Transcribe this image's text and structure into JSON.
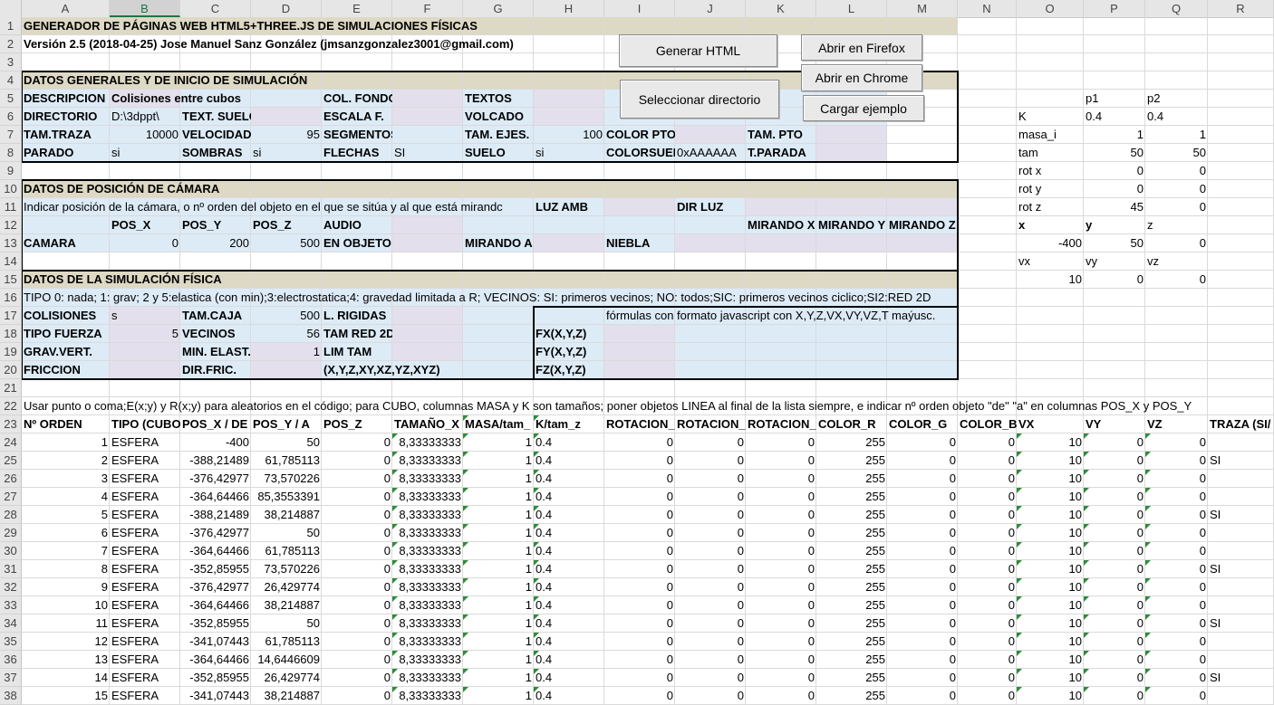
{
  "columns": [
    "A",
    "B",
    "C",
    "D",
    "E",
    "F",
    "G",
    "H",
    "I",
    "J",
    "K",
    "L",
    "M",
    "N",
    "O",
    "P",
    "Q",
    "R"
  ],
  "selected_column": "B",
  "rows": [
    "1",
    "2",
    "3",
    "4",
    "5",
    "6",
    "7",
    "8",
    "9",
    "10",
    "11",
    "12",
    "13",
    "14",
    "15",
    "16",
    "17",
    "18",
    "19",
    "20",
    "21",
    "22",
    "23",
    "24",
    "25",
    "26",
    "27",
    "28",
    "29",
    "30",
    "31",
    "32",
    "33",
    "34",
    "35",
    "36",
    "37",
    "38"
  ],
  "header": {
    "title": "GENERADOR DE PÁGINAS WEB HTML5+THREE.JS DE SIMULACIONES FÍSICAS",
    "version": "Versión 2.5 (2018-04-25) Jose Manuel Sanz González (jmsanzgonzalez3001@gmail.com)"
  },
  "buttons": {
    "generar": "Generar HTML",
    "seleccionar": "Seleccionar directorio",
    "firefox": "Abrir en Firefox",
    "chrome": "Abrir en Chrome",
    "ejemplo": "Cargar ejemplo"
  },
  "general": {
    "section": "DATOS GENERALES Y DE INICIO DE SIMULACIÓN",
    "descripcion_label": "DESCRIPCION",
    "descripcion_value": "Colisiones entre cubos",
    "col_fondo_label": "COL. FONDO",
    "textos_label": "TEXTOS",
    "directorio_label": "DIRECTORIO",
    "directorio_value": "D:\\3dppt\\",
    "text_suelo_label": "TEXT. SUELO",
    "escala_label": "ESCALA F.",
    "volcado_label": "VOLCADO",
    "tam_traza_label": "TAM.TRAZA",
    "tam_traza_value": "10000",
    "velocidad_label": "VELOCIDAD",
    "velocidad_value": "95",
    "segmentos_label": "SEGMENTOS",
    "tam_ejes_label": "TAM. EJES.",
    "tam_ejes_value": "100",
    "color_pto_label": "COLOR PTO",
    "tam_pto_label": "TAM. PTO",
    "parado_label": "PARADO",
    "parado_value": "si",
    "sombras_label": "SOMBRAS",
    "sombras_value": "si",
    "flechas_label": "FLECHAS",
    "flechas_value": "SI",
    "suelo_label": "SUELO",
    "suelo_value": "si",
    "colorsuelo_label": "COLORSUEL",
    "colorsuelo_value": "0xAAAAAA",
    "t_parada_label": "T.PARADA"
  },
  "camera": {
    "section": "DATOS DE POSICIÓN DE CÁMARA",
    "hint": "Indicar posición de la cámara, o nº orden del objeto en el que se sitúa y al que está mirandc",
    "luz_amb_label": "LUZ AMB",
    "dir_luz_label": "DIR LUZ",
    "pos_x_label": "POS_X",
    "pos_y_label": "POS_Y",
    "pos_z_label": "POS_Z",
    "audio_label": "AUDIO",
    "mirando_x_label": "MIRANDO X",
    "mirando_y_label": "MIRANDO Y",
    "mirando_z_label": "MIRANDO Z",
    "camara_label": "CAMARA",
    "pos_x_value": "0",
    "pos_y_value": "200",
    "pos_z_value": "500",
    "en_objeto_label": "EN OBJETO",
    "mirando_a_label": "MIRANDO A",
    "niebla_label": "NIEBLA"
  },
  "physics": {
    "section": "DATOS DE LA SIMULACIÓN FÍSICA",
    "tipo_hint": "TIPO 0: nada; 1: grav; 2 y 5:elastica (con min);3:electrostatica;4: gravedad limitada a R; VECINOS: SI: primeros vecinos; NO: todos;SIC: primeros vecinos ciclico;SI2:RED 2D",
    "colisiones_label": "COLISIONES",
    "colisiones_value": "s",
    "tam_caja_label": "TAM.CAJA",
    "tam_caja_value": "500",
    "l_rigidas_label": "L. RIGIDAS",
    "formulas_note": "fórmulas con formato javascript con X,Y,Z,VX,VY,VZ,T maýusc.",
    "tipo_fuerza_label": "TIPO FUERZA",
    "tipo_fuerza_value": "5",
    "vecinos_label": "VECINOS",
    "vecinos_value": "56",
    "tam_red_label": "TAM RED 2D",
    "fx_label": "FX(X,Y,Z)",
    "grav_vert_label": "GRAV.VERT.",
    "min_elast_label": "MIN. ELAST.",
    "min_elast_value": "1",
    "lim_tam_label": "LIM TAM",
    "fy_label": "FY(X,Y,Z)",
    "friccion_label": "FRICCION",
    "dir_fric_label": "DIR.FRIC.",
    "planes_label": "(X,Y,Z,XY,XZ,YZ,XYZ)",
    "fz_label": "FZ(X,Y,Z)"
  },
  "note_row22": "Usar punto o coma;E(x;y) y R(x;y) para aleatorios en el código; para CUBO, columnas MASA y K son tamaños; poner objetos LINEA al final de la lista siempre, e indicar nº orden objeto \"de\" \"a\" en columnas POS_X y POS_Y",
  "side_panel": {
    "p1": "p1",
    "p2": "p2",
    "k_label": "K",
    "k_p1": "0.4",
    "k_p2": "0.4",
    "masa_label": "masa_i",
    "masa_p1": "1",
    "masa_p2": "1",
    "tam_label": "tam",
    "tam_p1": "50",
    "tam_p2": "50",
    "rotx_label": "rot x",
    "rotx_p1": "0",
    "rotx_p2": "0",
    "roty_label": "rot y",
    "roty_p1": "0",
    "roty_p2": "0",
    "rotz_label": "rot z",
    "rotz_p1": "45",
    "rotz_p2": "0",
    "x_label": "x",
    "y_label": "y",
    "z_label": "z",
    "x_value": "-400",
    "y_value": "50",
    "z_value": "0",
    "vx_label": "vx",
    "vy_label": "vy",
    "vz_label": "vz",
    "vx_value": "10",
    "vy_value": "0",
    "vz_value": "0"
  },
  "table": {
    "headers": [
      "Nº ORDEN",
      "TIPO (CUBO,",
      "POS_X / DE",
      "POS_Y / A",
      "POS_Z",
      "TAMAÑO_X",
      "MASA/tam_",
      "K/tam_z",
      "ROTACION_",
      "ROTACION_",
      "ROTACION_",
      "COLOR_R",
      "COLOR_G",
      "COLOR_B",
      "VX",
      "VY",
      "VZ",
      "TRAZA (SI/"
    ],
    "rows": [
      [
        "1",
        "ESFERA",
        "-400",
        "50",
        "0",
        "8,33333333",
        "1",
        "0.4",
        "0",
        "0",
        "0",
        "255",
        "0",
        "0",
        "10",
        "0",
        "0",
        ""
      ],
      [
        "2",
        "ESFERA",
        "-388,21489",
        "61,785113",
        "0",
        "8,33333333",
        "1",
        "0.4",
        "0",
        "0",
        "0",
        "255",
        "0",
        "0",
        "10",
        "0",
        "0",
        "SI"
      ],
      [
        "3",
        "ESFERA",
        "-376,42977",
        "73,570226",
        "0",
        "8,33333333",
        "1",
        "0.4",
        "0",
        "0",
        "0",
        "255",
        "0",
        "0",
        "10",
        "0",
        "0",
        ""
      ],
      [
        "4",
        "ESFERA",
        "-364,64466",
        "85,3553391",
        "0",
        "8,33333333",
        "1",
        "0.4",
        "0",
        "0",
        "0",
        "255",
        "0",
        "0",
        "10",
        "0",
        "0",
        ""
      ],
      [
        "5",
        "ESFERA",
        "-388,21489",
        "38,214887",
        "0",
        "8,33333333",
        "1",
        "0.4",
        "0",
        "0",
        "0",
        "255",
        "0",
        "0",
        "10",
        "0",
        "0",
        "SI"
      ],
      [
        "6",
        "ESFERA",
        "-376,42977",
        "50",
        "0",
        "8,33333333",
        "1",
        "0.4",
        "0",
        "0",
        "0",
        "255",
        "0",
        "0",
        "10",
        "0",
        "0",
        ""
      ],
      [
        "7",
        "ESFERA",
        "-364,64466",
        "61,785113",
        "0",
        "8,33333333",
        "1",
        "0.4",
        "0",
        "0",
        "0",
        "255",
        "0",
        "0",
        "10",
        "0",
        "0",
        ""
      ],
      [
        "8",
        "ESFERA",
        "-352,85955",
        "73,570226",
        "0",
        "8,33333333",
        "1",
        "0.4",
        "0",
        "0",
        "0",
        "255",
        "0",
        "0",
        "10",
        "0",
        "0",
        "SI"
      ],
      [
        "9",
        "ESFERA",
        "-376,42977",
        "26,429774",
        "0",
        "8,33333333",
        "1",
        "0.4",
        "0",
        "0",
        "0",
        "255",
        "0",
        "0",
        "10",
        "0",
        "0",
        ""
      ],
      [
        "10",
        "ESFERA",
        "-364,64466",
        "38,214887",
        "0",
        "8,33333333",
        "1",
        "0.4",
        "0",
        "0",
        "0",
        "255",
        "0",
        "0",
        "10",
        "0",
        "0",
        ""
      ],
      [
        "11",
        "ESFERA",
        "-352,85955",
        "50",
        "0",
        "8,33333333",
        "1",
        "0.4",
        "0",
        "0",
        "0",
        "255",
        "0",
        "0",
        "10",
        "0",
        "0",
        "SI"
      ],
      [
        "12",
        "ESFERA",
        "-341,07443",
        "61,785113",
        "0",
        "8,33333333",
        "1",
        "0.4",
        "0",
        "0",
        "0",
        "255",
        "0",
        "0",
        "10",
        "0",
        "0",
        ""
      ],
      [
        "13",
        "ESFERA",
        "-364,64466",
        "14,6446609",
        "0",
        "8,33333333",
        "1",
        "0.4",
        "0",
        "0",
        "0",
        "255",
        "0",
        "0",
        "10",
        "0",
        "0",
        ""
      ],
      [
        "14",
        "ESFERA",
        "-352,85955",
        "26,429774",
        "0",
        "8,33333333",
        "1",
        "0.4",
        "0",
        "0",
        "0",
        "255",
        "0",
        "0",
        "10",
        "0",
        "0",
        "SI"
      ],
      [
        "15",
        "ESFERA",
        "-341,07443",
        "38,214887",
        "0",
        "8,33333333",
        "1",
        "0.4",
        "0",
        "0",
        "0",
        "255",
        "0",
        "0",
        "10",
        "0",
        "0",
        ""
      ]
    ]
  },
  "colors": {
    "title_fill": "#ddd9c4",
    "section_fill": "#ddebf7",
    "input_fill": "#e4dfec",
    "header_bg": "#e6e6e6",
    "selected_header": "#217346",
    "comment_marker": "#2e8b3a"
  }
}
